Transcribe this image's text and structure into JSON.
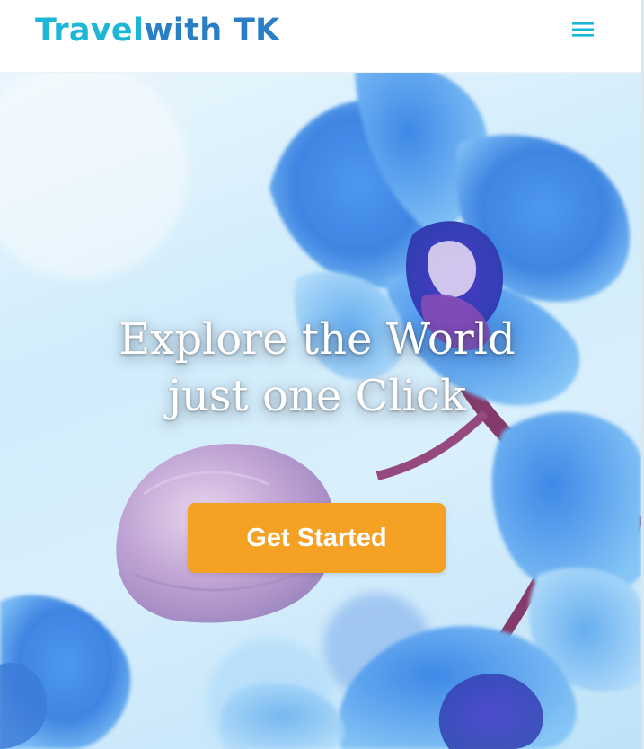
{
  "header": {
    "brand_part1": "Travel",
    "brand_part2": "with",
    "brand_part3": " TK",
    "menu_icon": "hamburger-icon"
  },
  "hero": {
    "headline_line1": "Explore the World",
    "headline_line2": "just one Click",
    "cta_label": "Get Started",
    "background_image": "blue-orchid-flowers"
  },
  "colors": {
    "brand_cyan": "#1cb7d7",
    "brand_blue": "#2a7fc4",
    "cta_orange": "#f4a124"
  }
}
